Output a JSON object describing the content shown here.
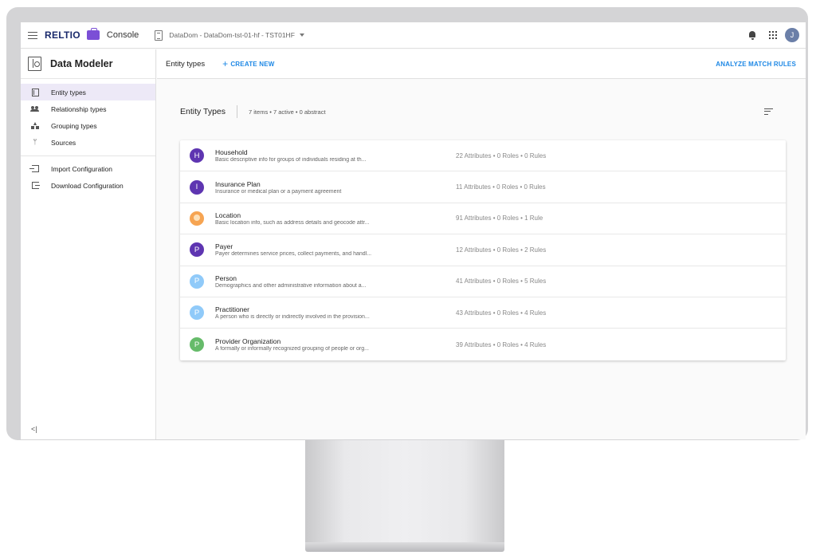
{
  "topbar": {
    "logo": "RELTIO",
    "app": "Console",
    "tenant": "DataDom - DataDom-tst-01-hf - TST01HF",
    "avatar_initial": "J"
  },
  "sidebar": {
    "title": "Data Modeler",
    "items": [
      {
        "label": "Entity types",
        "icon": "entity-types-icon",
        "active": true
      },
      {
        "label": "Relationship types",
        "icon": "relationship-types-icon",
        "active": false
      },
      {
        "label": "Grouping types",
        "icon": "grouping-types-icon",
        "active": false
      },
      {
        "label": "Sources",
        "icon": "sources-icon",
        "active": false
      }
    ],
    "actions": [
      {
        "label": "Import Configuration",
        "icon": "import-icon"
      },
      {
        "label": "Download Configuration",
        "icon": "download-icon"
      }
    ],
    "collapse_glyph": "<|"
  },
  "toolbar": {
    "title": "Entity types",
    "create_label": "CREATE NEW",
    "analyze_label": "ANALYZE MATCH RULES"
  },
  "content": {
    "title": "Entity Types",
    "stats": "7 items • 7 active • 0 abstract"
  },
  "entities": [
    {
      "letter": "H",
      "color": "#5e35b1",
      "name": "Household",
      "desc": "Basic descriptive info for groups of individuals residing at th...",
      "meta": "22 Attributes  •  0 Roles  •  0 Rules"
    },
    {
      "letter": "I",
      "color": "#5e35b1",
      "name": "Insurance Plan",
      "desc": "Insurance or medical plan or a payment agreement",
      "meta": "11 Attributes  •  0 Roles  •  0 Rules"
    },
    {
      "letter": "",
      "color": "#f6a452",
      "name": "Location",
      "desc": "Basic location info, such as address details and geocode attr...",
      "meta": "91 Attributes  •  0 Roles  •  1 Rule"
    },
    {
      "letter": "P",
      "color": "#5e35b1",
      "name": "Payer",
      "desc": "Payer determines service prices, collect payments, and handl...",
      "meta": "12 Attributes  •  0 Roles  •  2 Rules"
    },
    {
      "letter": "P",
      "color": "#90caf9",
      "name": "Person",
      "desc": "Demographics and other administrative information about a...",
      "meta": "41 Attributes  •  0 Roles  •  5 Rules"
    },
    {
      "letter": "P",
      "color": "#90caf9",
      "name": "Practitioner",
      "desc": "A person who is directly or indirectly involved in the provision...",
      "meta": "43 Attributes  •  0 Roles  •  4 Rules"
    },
    {
      "letter": "P",
      "color": "#66bb6a",
      "name": "Provider Organization",
      "desc": "A formally or informally recognized grouping of people or org...",
      "meta": "39 Attributes  •  0 Roles  •  4 Rules"
    }
  ]
}
